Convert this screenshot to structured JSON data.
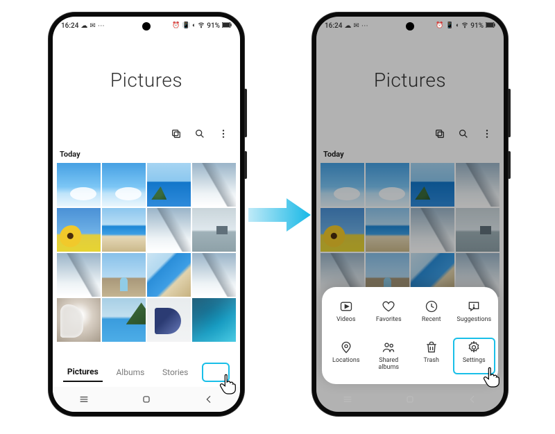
{
  "statusbar": {
    "time": "16:24",
    "battery_percent": "91%"
  },
  "hero_title": "Pictures",
  "section_label": "Today",
  "tabs": {
    "pictures": "Pictures",
    "albums": "Albums",
    "stories": "Stories"
  },
  "sheet": {
    "videos": "Videos",
    "favorites": "Favorites",
    "recent": "Recent",
    "suggestions": "Suggestions",
    "locations": "Locations",
    "shared_albums": "Shared\nalbums",
    "trash": "Trash",
    "settings": "Settings"
  }
}
